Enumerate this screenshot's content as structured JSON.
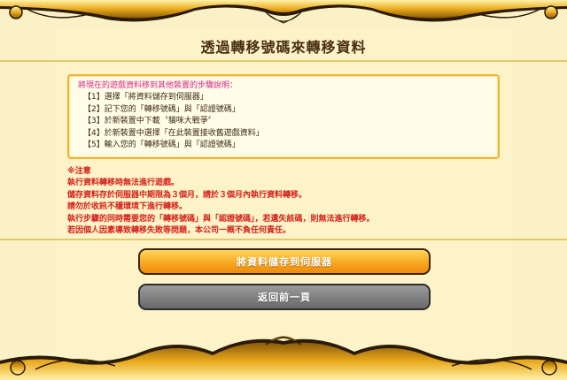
{
  "page": {
    "title": "透過轉移號碼來轉移資料"
  },
  "steps": {
    "heading": "將現在的遊戲資料移到其他裝置的步驟說明：",
    "items": [
      "【1】選擇「將資料儲存到伺服器」",
      "【2】記下您的「轉移號碼」與「認證號碼」",
      "【3】於新裝置中下載〝貓咪大戰爭〞",
      "【4】於新裝置中選擇「在此裝置接收舊遊戲資料」",
      "【5】輸入您的「轉移號碼」與「認證號碼」"
    ]
  },
  "notes": {
    "heading": "※注意",
    "items": [
      "執行資料轉移時無法進行遊戲。",
      "儲存資料存於伺服器中期限為３個月，請於３個月內執行資料轉移。",
      "請勿於收訊不穩環境下進行轉移。",
      "執行步驟的同時需要您的「轉移號碼」與「認證號碼」，若遺失該碼，則無法進行轉移。",
      "若因個人因素導致轉移失敗等問題，本公司一概不負任何責任。"
    ]
  },
  "buttons": {
    "save_label": "將資料儲存到伺服器",
    "back_label": "返回前一頁"
  },
  "colors": {
    "background": "#fbf1c6",
    "accent_gold": "#f0b230",
    "note_red": "#d5201a",
    "heading_magenta": "#d6278a"
  }
}
